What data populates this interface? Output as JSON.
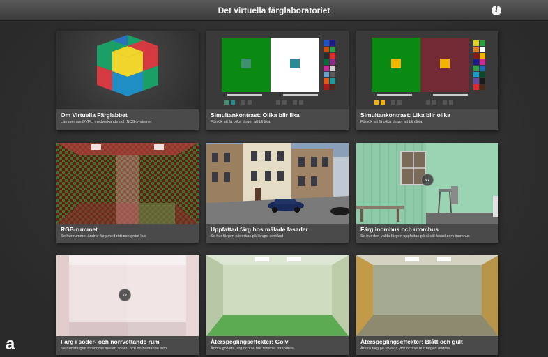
{
  "header": {
    "title": "Det virtuella färglaboratoriet",
    "info_icon_glyph": "i"
  },
  "corner_label": "a",
  "arrow_glyph": "‹›",
  "cards": [
    {
      "title": "Om Virtuella Färglabbet",
      "subtitle": "Läs mer om DVFL, medverkande och NCS-systemet"
    },
    {
      "title": "Simultankontrast: Olika blir lika",
      "subtitle": "Försök att få olika färger att bli lika."
    },
    {
      "title": "Simultankontrast: Lika blir olika",
      "subtitle": "Försök att få olika färger att bli olika."
    },
    {
      "title": "RGB-rummet",
      "subtitle": "Se hur rummet ändrar färg med rött och grönt ljus"
    },
    {
      "title": "Uppfattad färg hos målade fasader",
      "subtitle": "Se hur färgen påverkas på längre avstånd"
    },
    {
      "title": "Färg inomhus och utomhus",
      "subtitle": "Se hur den valda färgen uppfattas på såväl fasad som inomhus"
    },
    {
      "title": "Färg i söder- och norrvettande rum",
      "subtitle": "Se rumsfärgen förändras mellan söder- och norrvettande rum"
    },
    {
      "title": "Återspeglingseffekter: Golv",
      "subtitle": "Ändra golvets färg och se hur rummet förändras"
    },
    {
      "title": "Återspeglingseffekter: Blått och gult",
      "subtitle": "Ändra färg på utvalda ytor och se hur färgen ändras"
    }
  ],
  "colors": {
    "green": "#0a8a12",
    "maroon": "#742a34",
    "teal": "#2a8a94",
    "yellow": "#f2b400",
    "sage": "#3f8f6e"
  }
}
